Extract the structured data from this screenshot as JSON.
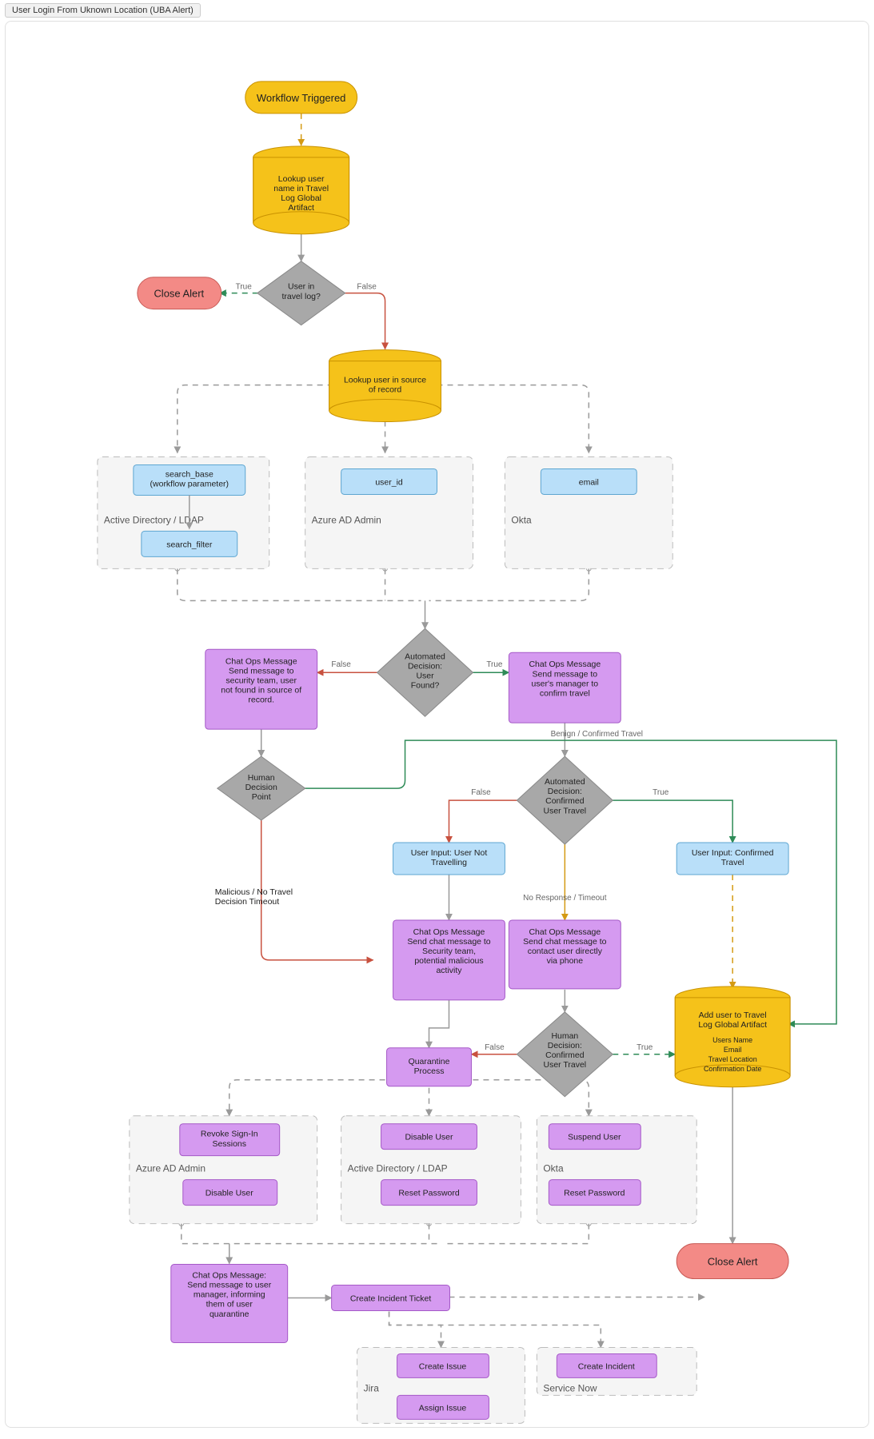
{
  "tab": "User Login From Uknown Location (UBA Alert)",
  "nodes": {
    "start": "Workflow Triggered",
    "lookup_travel": "Lookup user\nname in Travel\nLog Global\nArtifact",
    "user_in_travel": "User in\ntravel log?",
    "close_alert_1": "Close Alert",
    "lookup_source": "Lookup user in source\nof record",
    "user_found": "Automated\nDecision:\nUser\nFound?",
    "chat_not_found": "Chat Ops Message\nSend message to\nsecurity team, user\nnot found in source of\nrecord.",
    "chat_confirm_travel": "Chat Ops Message\nSend message to\nuser's manager to\nconfirm travel",
    "human1": "Human\nDecision\nPoint",
    "auto_confirmed": "Automated\nDecision:\nConfirmed\nUser Travel",
    "user_not_trav": "User Input: User Not\nTravelling",
    "user_conf_trav": "User Input: Confirmed\nTravel",
    "chat_potential": "Chat Ops Message\nSend chat message to\nSecurity team,\npotential malicious\nactivity",
    "chat_phone": "Chat Ops Message\nSend chat message to\ncontact user directly\nvia phone",
    "human2": "Human\nDecision:\nConfirmed\nUser Travel",
    "quarantine": "Quarantine\nProcess",
    "add_travel_hdr": "Add user to Travel\nLog Global Artifact",
    "add_travel_f1": "Users Name",
    "add_travel_f2": "Email",
    "add_travel_f3": "Travel Location",
    "add_travel_f4": "Confirmation Date",
    "revoke": "Revoke Sign-In\nSessions",
    "disable_azure": "Disable User",
    "disable_ad": "Disable User",
    "reset_ad": "Reset Password",
    "suspend": "Suspend User",
    "reset_okta": "Reset Password",
    "close_alert_2": "Close Alert",
    "chat_quarantine": "Chat Ops Message:\nSend message to user\nmanager, informing\nthem of user\nquarantine",
    "create_ticket": "Create Incident Ticket",
    "create_issue": "Create Issue",
    "assign_issue": "Assign Issue",
    "create_incident": "Create Incident"
  },
  "groups": {
    "ad_ldap": "Active Directory / LDAP",
    "azure": "Azure AD Admin",
    "okta": "Okta",
    "jira": "Jira",
    "service_now": "Service Now"
  },
  "params": {
    "search_base": "search_base\n(workflow parameter)",
    "search_filter": "search_filter",
    "user_id": "user_id",
    "email": "email"
  },
  "edge_labels": {
    "true": "True",
    "false": "False",
    "benign": "Benign / Confirmed Travel",
    "no_resp": "No Response / Timeout",
    "malicious": "Malicious / No Travel\nDecision Timeout"
  }
}
